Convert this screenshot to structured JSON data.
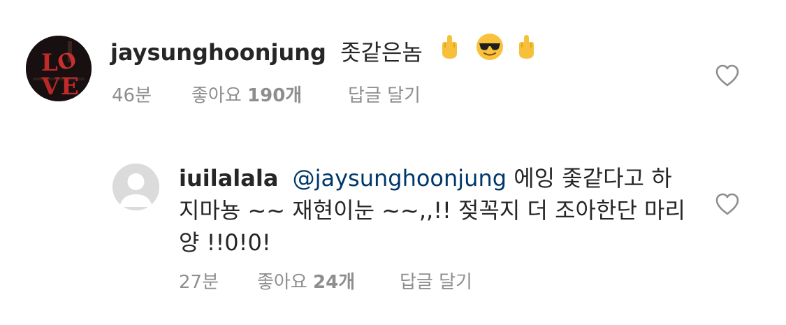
{
  "comments": [
    {
      "username": "jaysunghoonjung",
      "text": "좃같은놈",
      "emojis": [
        "middle-finger-icon",
        "sunglasses-face-icon",
        "middle-finger-icon"
      ],
      "avatar": "love-sculpture-avatar",
      "time": "46분",
      "likes_prefix": "좋아요",
      "likes_count": "190개",
      "reply_label": "답글 달기"
    },
    {
      "username": "iuilalala",
      "mention": "@jaysunghoonjung",
      "text": " 에잉 좇같다고 하지마뇽 ~~ 재현이눈 ~~,,!! 젖꼭지 더 조아한단 마리양 !!0!0!",
      "avatar": "default-avatar",
      "time": "27분",
      "likes_prefix": "좋아요",
      "likes_count": "24개",
      "reply_label": "답글 달기"
    }
  ],
  "colors": {
    "text": "#262626",
    "secondary": "#8e8e8e",
    "mention": "#00376b",
    "avatar_placeholder": "#dbdbdb"
  }
}
